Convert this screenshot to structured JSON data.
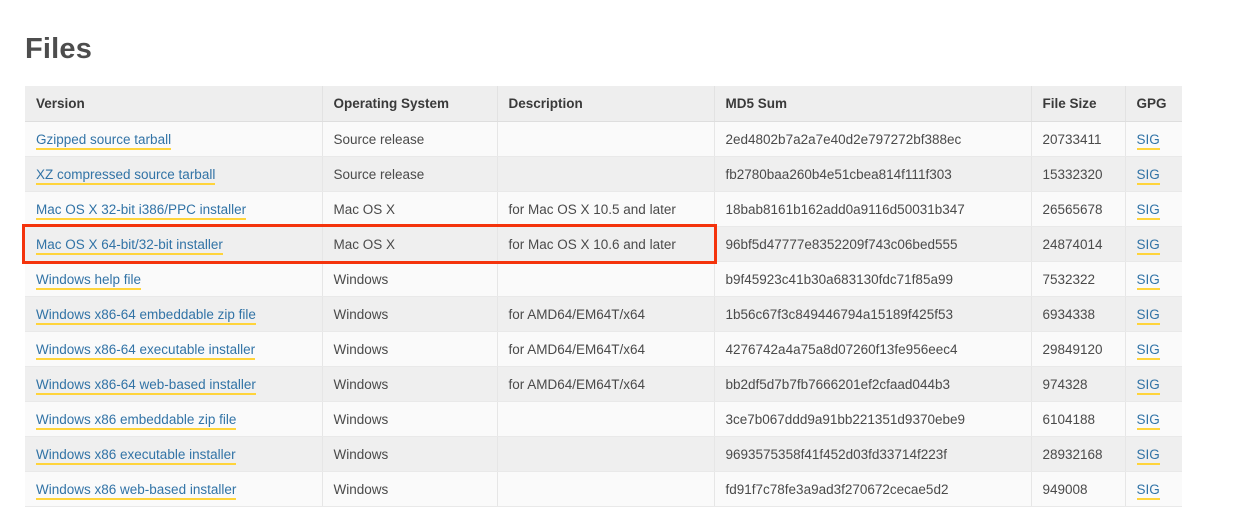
{
  "page": {
    "title": "Files",
    "accent_link_color": "#3173a6",
    "link_underline_color": "#ffd43b",
    "highlight_color": "#f4330c",
    "header_bg": "#eeeeee",
    "row_odd_bg": "#fafafa",
    "row_even_bg": "#efefef"
  },
  "table": {
    "columns": [
      "Version",
      "Operating System",
      "Description",
      "MD5 Sum",
      "File Size",
      "GPG"
    ],
    "gpg_label": "SIG",
    "rows": [
      {
        "version": "Gzipped source tarball",
        "os": "Source release",
        "description": "",
        "md5": "2ed4802b7a2a7e40d2e797272bf388ec",
        "size": "20733411",
        "gpg": "SIG",
        "highlighted": false
      },
      {
        "version": "XZ compressed source tarball",
        "os": "Source release",
        "description": "",
        "md5": "fb2780baa260b4e51cbea814f111f303",
        "size": "15332320",
        "gpg": "SIG",
        "highlighted": false
      },
      {
        "version": "Mac OS X 32-bit i386/PPC installer",
        "os": "Mac OS X",
        "description": "for Mac OS X 10.5 and later",
        "md5": "18bab8161b162add0a9116d50031b347",
        "size": "26565678",
        "gpg": "SIG",
        "highlighted": false
      },
      {
        "version": "Mac OS X 64-bit/32-bit installer",
        "os": "Mac OS X",
        "description": "for Mac OS X 10.6 and later",
        "md5": "96bf5d47777e8352209f743c06bed555",
        "size": "24874014",
        "gpg": "SIG",
        "highlighted": true
      },
      {
        "version": "Windows help file",
        "os": "Windows",
        "description": "",
        "md5": "b9f45923c41b30a683130fdc71f85a99",
        "size": "7532322",
        "gpg": "SIG",
        "highlighted": false
      },
      {
        "version": "Windows x86-64 embeddable zip file",
        "os": "Windows",
        "description": "for AMD64/EM64T/x64",
        "md5": "1b56c67f3c849446794a15189f425f53",
        "size": "6934338",
        "gpg": "SIG",
        "highlighted": false
      },
      {
        "version": "Windows x86-64 executable installer",
        "os": "Windows",
        "description": "for AMD64/EM64T/x64",
        "md5": "4276742a4a75a8d07260f13fe956eec4",
        "size": "29849120",
        "gpg": "SIG",
        "highlighted": false
      },
      {
        "version": "Windows x86-64 web-based installer",
        "os": "Windows",
        "description": "for AMD64/EM64T/x64",
        "md5": "bb2df5d7b7fb7666201ef2cfaad044b3",
        "size": "974328",
        "gpg": "SIG",
        "highlighted": false
      },
      {
        "version": "Windows x86 embeddable zip file",
        "os": "Windows",
        "description": "",
        "md5": "3ce7b067ddd9a91bb221351d9370ebe9",
        "size": "6104188",
        "gpg": "SIG",
        "highlighted": false
      },
      {
        "version": "Windows x86 executable installer",
        "os": "Windows",
        "description": "",
        "md5": "9693575358f41f452d03fd33714f223f",
        "size": "28932168",
        "gpg": "SIG",
        "highlighted": false
      },
      {
        "version": "Windows x86 web-based installer",
        "os": "Windows",
        "description": "",
        "md5": "fd91f7c78fe3a9ad3f270672cecae5d2",
        "size": "949008",
        "gpg": "SIG",
        "highlighted": false
      }
    ]
  }
}
